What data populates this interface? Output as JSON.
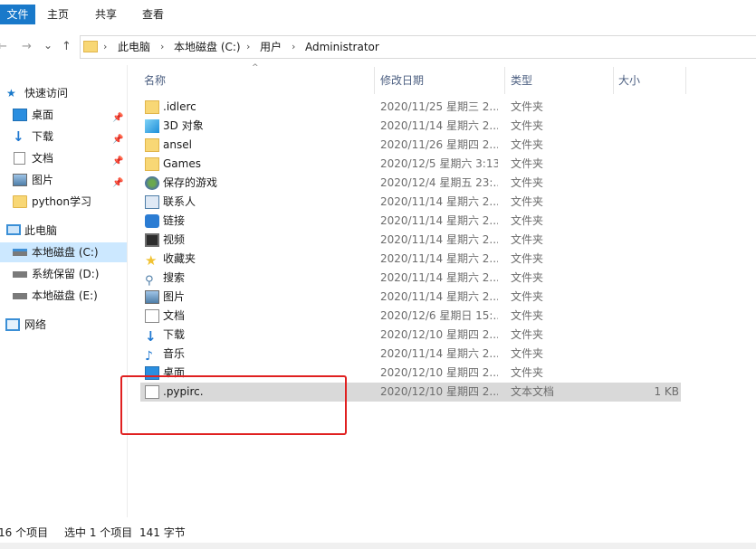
{
  "ribbon": {
    "file_tab": "文件",
    "tabs": [
      "主页",
      "共享",
      "查看"
    ]
  },
  "nav": {
    "back": "←",
    "forward": "→",
    "dropdown": "⌄",
    "up": "↑",
    "separator": "›",
    "breadcrumb": [
      "此电脑",
      "本地磁盘 (C:)",
      "用户",
      "Administrator"
    ]
  },
  "sidebar": {
    "quick_access": "快速访问",
    "quick_items": [
      "桌面",
      "下载",
      "文档",
      "图片",
      "python学习"
    ],
    "this_pc": "此电脑",
    "drives": [
      "本地磁盘 (C:)",
      "系统保留 (D:)",
      "本地磁盘 (E:)"
    ],
    "network": "网络"
  },
  "columns": {
    "name": "名称",
    "date": "修改日期",
    "type": "类型",
    "size": "大小"
  },
  "files": [
    {
      "name": ".idlerc",
      "date": "2020/11/25 星期三 2...",
      "type": "文件夹",
      "size": "",
      "icon": "folder-icon"
    },
    {
      "name": "3D 对象",
      "date": "2020/11/14 星期六 2...",
      "type": "文件夹",
      "size": "",
      "icon": "3d-objects-icon"
    },
    {
      "name": "ansel",
      "date": "2020/11/26 星期四 2...",
      "type": "文件夹",
      "size": "",
      "icon": "folder-icon"
    },
    {
      "name": "Games",
      "date": "2020/12/5 星期六 3:13",
      "type": "文件夹",
      "size": "",
      "icon": "folder-icon"
    },
    {
      "name": "保存的游戏",
      "date": "2020/12/4 星期五 23:...",
      "type": "文件夹",
      "size": "",
      "icon": "saved-games-icon"
    },
    {
      "name": "联系人",
      "date": "2020/11/14 星期六 2...",
      "type": "文件夹",
      "size": "",
      "icon": "contacts-icon"
    },
    {
      "name": "链接",
      "date": "2020/11/14 星期六 2...",
      "type": "文件夹",
      "size": "",
      "icon": "links-icon"
    },
    {
      "name": "视频",
      "date": "2020/11/14 星期六 2...",
      "type": "文件夹",
      "size": "",
      "icon": "videos-icon"
    },
    {
      "name": "收藏夹",
      "date": "2020/11/14 星期六 2...",
      "type": "文件夹",
      "size": "",
      "icon": "favorites-icon"
    },
    {
      "name": "搜索",
      "date": "2020/11/14 星期六 2...",
      "type": "文件夹",
      "size": "",
      "icon": "searches-icon"
    },
    {
      "name": "图片",
      "date": "2020/11/14 星期六 2...",
      "type": "文件夹",
      "size": "",
      "icon": "pictures-icon"
    },
    {
      "name": "文档",
      "date": "2020/12/6 星期日 15:...",
      "type": "文件夹",
      "size": "",
      "icon": "documents-icon"
    },
    {
      "name": "下载",
      "date": "2020/12/10 星期四 2...",
      "type": "文件夹",
      "size": "",
      "icon": "downloads-icon"
    },
    {
      "name": "音乐",
      "date": "2020/11/14 星期六 2...",
      "type": "文件夹",
      "size": "",
      "icon": "music-icon"
    },
    {
      "name": "桌面",
      "date": "2020/12/10 星期四 2...",
      "type": "文件夹",
      "size": "",
      "icon": "desktop-icon"
    },
    {
      "name": ".pypirc.",
      "date": "2020/12/10 星期四 2...",
      "type": "文本文档",
      "size": "1 KB",
      "icon": "text-file-icon"
    }
  ],
  "status": {
    "count": "16 个项目",
    "selection": "选中 1 个项目",
    "size": "141 字节"
  },
  "colors": {
    "accent": "#1979ca",
    "selection": "#cce8ff",
    "highlight_box": "#e02020",
    "folder": "#f8d775"
  }
}
